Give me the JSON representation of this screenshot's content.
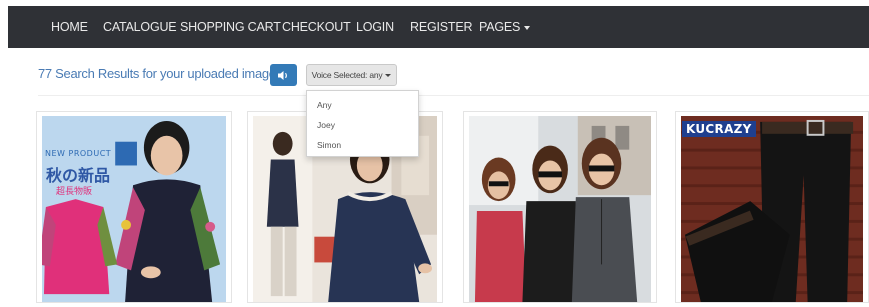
{
  "nav": {
    "items": [
      {
        "label": "HOME",
        "id": "home"
      },
      {
        "label": "CATALOGUE",
        "id": "catalogue"
      },
      {
        "label": "SHOPPING CART",
        "id": "shopping-cart"
      },
      {
        "label": "CHECKOUT",
        "id": "checkout"
      },
      {
        "label": "LOGIN",
        "id": "login"
      },
      {
        "label": "REGISTER",
        "id": "register"
      },
      {
        "label": "PAGES",
        "id": "pages",
        "has_caret": true
      }
    ]
  },
  "search": {
    "results_text": "77 Search Results for your uploaded image",
    "voice_icon": "volume-icon",
    "voice_dropdown_label": "Voice Selected: any"
  },
  "voice_options": [
    "Any",
    "Joey",
    "Simon"
  ],
  "products": [
    {
      "name": "product-1",
      "overlay": {
        "badge": "NEW PRODUCT",
        "title": "秋の新品",
        "subtitle": "超長物販"
      }
    },
    {
      "name": "product-2"
    },
    {
      "name": "product-3"
    },
    {
      "name": "product-4",
      "overlay": {
        "brand": "KUCRAZY"
      }
    }
  ],
  "colors": {
    "navbar": "#2f3136",
    "accent": "#337ab7",
    "results_text": "#4a7bb4"
  }
}
